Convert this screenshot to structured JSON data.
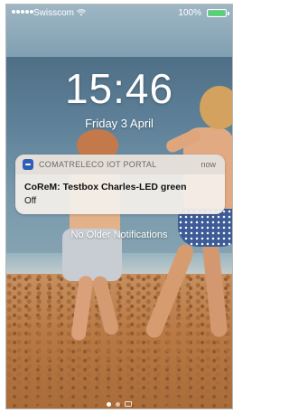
{
  "status_bar": {
    "carrier": "Swisscom",
    "battery_percent": "100%",
    "battery_level": 1.0,
    "signal_icon": "signal-dots-icon",
    "wifi_icon": "wifi-icon",
    "battery_icon": "battery-icon",
    "battery_color": "#4cd964"
  },
  "lock_screen": {
    "time": "15:46",
    "date": "Friday 3 April"
  },
  "notification": {
    "app_name": "COMATRELECO IOT PORTAL",
    "time": "now",
    "title": "CoReM: Testbox Charles-LED green",
    "body": "Off",
    "app_icon": "comatreleco-app-icon",
    "app_icon_color": "#2e5fb8"
  },
  "footer_text": "No Older Notifications",
  "page_indicator": {
    "total_dots": 2,
    "active_index": 0,
    "camera_icon": "camera-icon"
  }
}
